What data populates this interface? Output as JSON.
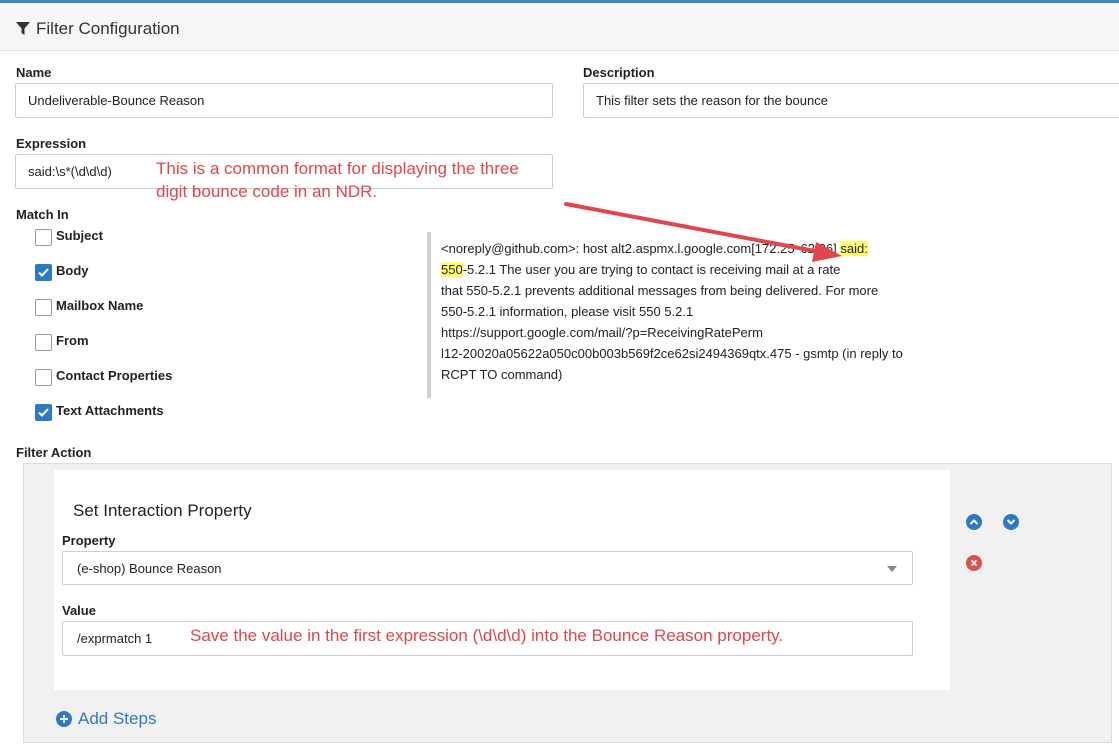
{
  "header": {
    "title": "Filter Configuration",
    "icon": "filter-icon"
  },
  "form": {
    "name_label": "Name",
    "name_value": "Undeliverable-Bounce Reason",
    "description_label": "Description",
    "description_value": "This filter sets the reason for the bounce",
    "expression_label": "Expression",
    "expression_value": "said:\\s*(\\d\\d\\d)",
    "expression_note_line1": "This is a common format for displaying the three",
    "expression_note_line2": "digit bounce code in an NDR.",
    "match_in_label": "Match In",
    "match_in": [
      {
        "label": "Subject",
        "checked": false
      },
      {
        "label": "Body",
        "checked": true
      },
      {
        "label": "Mailbox Name",
        "checked": false
      },
      {
        "label": "From",
        "checked": false
      },
      {
        "label": "Contact Properties",
        "checked": false
      },
      {
        "label": "Text Attachments",
        "checked": true
      }
    ]
  },
  "sample": {
    "line1_before": "<noreply@github.com>: host alt2.aspmx.l.google.com[172.25",
    "line1_mid": "62.26]",
    "line1_hl": "said:",
    "line2_hl": "550",
    "line2_after": "-5.2.1 The user you are trying to contact is receiving mail at a rate",
    "line3": "that 550-5.2.1 prevents additional messages from being delivered. For more",
    "line4": "550-5.2.1 information, please visit 550 5.2.1",
    "line5": "https://support.google.com/mail/?p=ReceivingRatePerm",
    "line6": "l12-20020a05622a050c00b003b569f2ce62si2494369qtx.475 - gsmtp (in reply to",
    "line7": "RCPT TO command)"
  },
  "filter_action": {
    "label": "Filter Action",
    "step_title": "Set Interaction Property",
    "property_label": "Property",
    "property_value": "(e-shop) Bounce Reason",
    "value_label": "Value",
    "value_value": "/exprmatch 1",
    "value_note": "Save the value in the first expression (\\d\\d\\d) into the Bounce Reason property.",
    "add_steps_label": "Add Steps"
  },
  "colors": {
    "accent": "#2e79c3",
    "note_red": "#e0464a",
    "highlight": "#ffff6a",
    "danger": "#d9534f"
  }
}
